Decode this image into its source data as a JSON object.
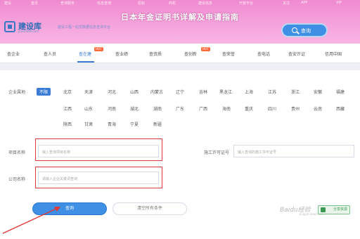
{
  "banner": {
    "title": "日本年金证明书详解及申请指南"
  },
  "topnav": [
    "建设",
    "首页",
    "查询服务",
    "信息查询",
    "招标",
    "商机",
    "建设信息",
    "开放平台",
    "关注",
    "APP",
    "VIP"
  ],
  "logo": {
    "name": "建设库",
    "domain": "jianshe99.com",
    "slogan": "建设工程一站式数据信息查询平台"
  },
  "header_search": {
    "label": "查询"
  },
  "tabs": [
    {
      "label": "查企业",
      "hot": ""
    },
    {
      "label": "查人员",
      "hot": ""
    },
    {
      "label": "查在建",
      "hot": "HOT",
      "active": true
    },
    {
      "label": "查业绩",
      "hot": ""
    },
    {
      "label": "查资质",
      "hot": ""
    },
    {
      "label": "查创新",
      "hot": "HOT"
    },
    {
      "label": "查荣誉",
      "hot": ""
    },
    {
      "label": "查电话",
      "hot": ""
    },
    {
      "label": "查安许证",
      "hot": ""
    },
    {
      "label": "信用中国",
      "hot": ""
    }
  ],
  "region_filter": {
    "label": "企业属地",
    "selected": "不限",
    "rows": [
      [
        "北京",
        "天津",
        "河北",
        "山西",
        "内蒙古",
        "辽宁",
        "吉林",
        "黑龙江",
        "上海",
        "江苏",
        "浙江",
        "安徽",
        "福建"
      ],
      [
        "江西",
        "山东",
        "河南",
        "湖北",
        "湖南",
        "广东",
        "广西",
        "海南",
        "重庆",
        "四川",
        "贵州",
        "云南",
        "西藏"
      ],
      [
        "陕西",
        "甘肃",
        "青海",
        "宁夏",
        "新疆"
      ]
    ]
  },
  "project_name": {
    "label": "项目名称",
    "placeholder": "输入查询项目名称"
  },
  "permit_no": {
    "label": "施工许可证号",
    "placeholder": "输入查询的施工许可证号"
  },
  "company_name": {
    "label": "公司名称",
    "placeholder": "请输入企业关键词查询"
  },
  "actions": {
    "query": "查询",
    "clear": "清空所有条件"
  },
  "watermark": {
    "text": "Baidu经验",
    "sub": "jingyan.baidu.com",
    "badge": "分享资源"
  },
  "colors": {
    "banner": "#f5a2dc",
    "accent": "#3a7bd5",
    "highlight": "#e03a3a"
  }
}
